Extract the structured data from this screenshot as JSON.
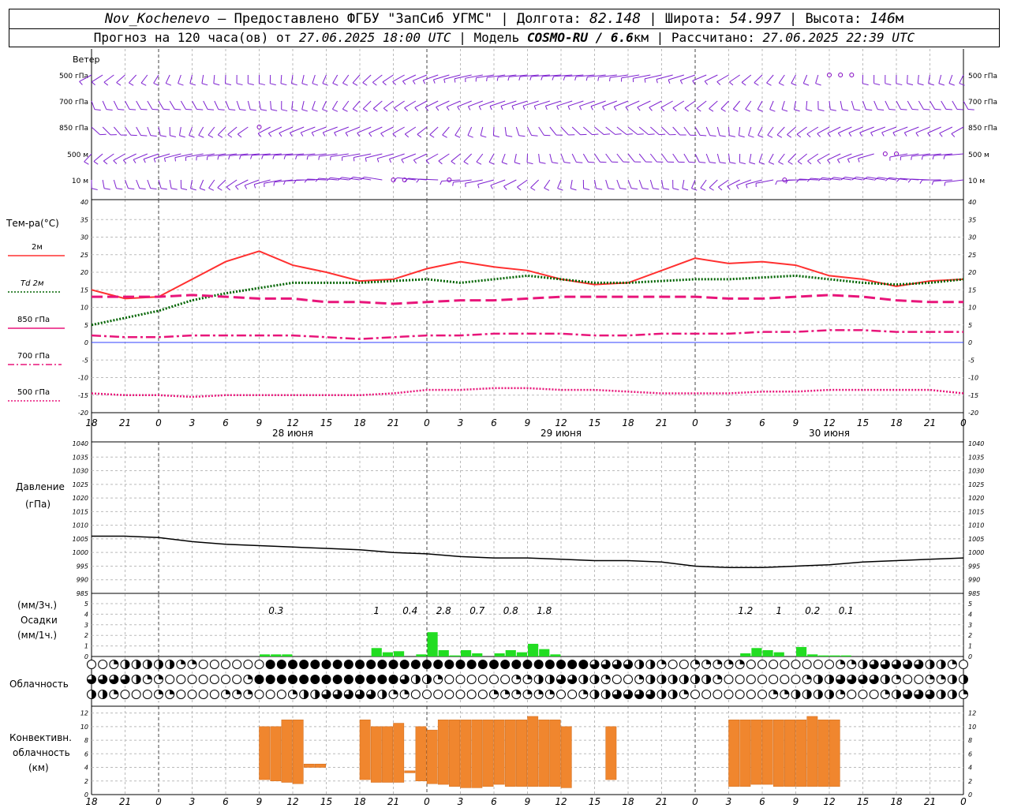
{
  "header": {
    "station": "Nov_Kochenevo",
    "provider": "Предоставлено ФГБУ \"ЗапСиб УГМС\"",
    "lon_label": "Долгота:",
    "lon": "82.148",
    "lat_label": "Широта:",
    "lat": "54.997",
    "alt_label": "Высота:",
    "alt": "146",
    "alt_unit": "м",
    "forecast_label": "Прогноз на 120 часа(ов) от",
    "forecast_from": "27.06.2025 18:00 UTC",
    "model_label": "Модель",
    "model": "COSMO-RU / 6.6",
    "model_unit": "км",
    "computed_label": "Рассчитано:",
    "computed": "27.06.2025 22:39 UTC"
  },
  "wind": {
    "title": "Ветер",
    "levels": [
      "500 гПа",
      "700 гПа",
      "850 гПа",
      "500 м",
      "10  м"
    ]
  },
  "temperature": {
    "title": "Тем-ра(°C)",
    "legend": [
      {
        "label": "2м",
        "color": "#ff3030",
        "style": "solid"
      },
      {
        "label": "Td  2м",
        "color": "#006400",
        "style": "dotted"
      },
      {
        "label": "850 гПа",
        "color": "#e8157a",
        "style": "dash"
      },
      {
        "label": "700 гПа",
        "color": "#e8157a",
        "style": "dashdot"
      },
      {
        "label": "500 гПа",
        "color": "#e8157a",
        "style": "dot"
      }
    ]
  },
  "pressure": {
    "title": "Давление",
    "unit": "(гПа)"
  },
  "precip": {
    "title1": "(мм/3ч.)",
    "title2": "Осадки",
    "title3": "(мм/1ч.)"
  },
  "cloudiness": {
    "title": "Облачность"
  },
  "convective": {
    "title1": "Конвективн.",
    "title2": "облачность",
    "title3": "(км)"
  },
  "time_axis": {
    "hour_labels": [
      "18",
      "21",
      "0",
      "3",
      "6",
      "9",
      "12",
      "15",
      "18",
      "21",
      "0",
      "3",
      "6",
      "9",
      "12",
      "15",
      "18",
      "21",
      "0",
      "3",
      "6",
      "9",
      "12",
      "15",
      "18",
      "21",
      "0"
    ],
    "day_labels": [
      "28 июня",
      "29 июня",
      "30 июня"
    ]
  },
  "chart_data": [
    {
      "type": "line",
      "title": "Тем-ра(°C)",
      "x_hours": [
        0,
        3,
        6,
        9,
        12,
        15,
        18,
        21,
        24,
        27,
        30,
        33,
        36,
        39,
        42,
        45,
        48,
        51,
        54,
        57,
        60,
        63,
        66,
        69,
        72,
        75,
        78
      ],
      "ylim": [
        -20,
        40
      ],
      "series": [
        {
          "name": "2м",
          "values": [
            15,
            12.5,
            13,
            18,
            23,
            26,
            22,
            20,
            17.5,
            18,
            21,
            23,
            21.5,
            20.5,
            18,
            16.5,
            17,
            20.5,
            24,
            22.5,
            23,
            22,
            19,
            18,
            16,
            17.5,
            18
          ]
        },
        {
          "name": "Td  2м",
          "values": [
            5,
            7,
            9,
            12,
            14,
            15.5,
            17,
            17,
            17,
            17.5,
            18,
            17,
            18,
            19,
            18,
            17,
            17,
            17.5,
            18,
            18,
            18.5,
            19,
            18,
            17,
            16.5,
            17,
            18
          ]
        },
        {
          "name": "850 гПа",
          "values": [
            13,
            13,
            13,
            13.5,
            13,
            12.5,
            12.5,
            11.5,
            11.5,
            11,
            11.5,
            12,
            12,
            12.5,
            13,
            13,
            13,
            13,
            13,
            12.5,
            12.5,
            13,
            13.5,
            13,
            12,
            11.5,
            11.5
          ]
        },
        {
          "name": "700 гПа",
          "values": [
            2,
            1.5,
            1.5,
            2,
            2,
            2,
            2,
            1.5,
            1,
            1.5,
            2,
            2,
            2.5,
            2.5,
            2.5,
            2,
            2,
            2.5,
            2.5,
            2.5,
            3,
            3,
            3.5,
            3.5,
            3,
            3,
            3
          ]
        },
        {
          "name": "500 гПа",
          "values": [
            -14.5,
            -15,
            -15,
            -15.5,
            -15,
            -15,
            -15,
            -15,
            -15,
            -14.5,
            -13.5,
            -13.5,
            -13,
            -13,
            -13.5,
            -13.5,
            -14,
            -14.5,
            -14.5,
            -14.5,
            -14,
            -14,
            -13.5,
            -13.5,
            -13.5,
            -13.5,
            -14.5
          ]
        }
      ]
    },
    {
      "type": "line",
      "title": "Давление (гПа)",
      "x_hours": [
        0,
        3,
        6,
        9,
        12,
        15,
        18,
        21,
        24,
        27,
        30,
        33,
        36,
        39,
        42,
        45,
        48,
        51,
        54,
        57,
        60,
        63,
        66,
        69,
        72,
        75,
        78
      ],
      "ylim": [
        985,
        1040
      ],
      "series": [
        {
          "name": "Давление",
          "values": [
            1006,
            1006,
            1005.5,
            1004,
            1003,
            1002.5,
            1002,
            1001.5,
            1001,
            1000,
            999.5,
            998.5,
            998,
            998,
            997.5,
            997,
            997,
            996.5,
            995,
            994.5,
            994.5,
            995,
            995.5,
            996.5,
            997,
            997.5,
            998
          ]
        }
      ]
    },
    {
      "type": "bar",
      "title": "Осадки",
      "ylim": [
        0,
        5
      ],
      "hourly_mm": [
        {
          "h": 15.5,
          "v": 0.2
        },
        {
          "h": 16.5,
          "v": 0.2
        },
        {
          "h": 17.5,
          "v": 0.2
        },
        {
          "h": 25.5,
          "v": 0.8
        },
        {
          "h": 26.5,
          "v": 0.4
        },
        {
          "h": 27.5,
          "v": 0.5
        },
        {
          "h": 29.5,
          "v": 0.2
        },
        {
          "h": 30.5,
          "v": 2.3
        },
        {
          "h": 31.5,
          "v": 0.6
        },
        {
          "h": 32.5,
          "v": 0.1
        },
        {
          "h": 33.5,
          "v": 0.6
        },
        {
          "h": 34.5,
          "v": 0.3
        },
        {
          "h": 36.5,
          "v": 0.3
        },
        {
          "h": 37.5,
          "v": 0.6
        },
        {
          "h": 38.5,
          "v": 0.4
        },
        {
          "h": 39.5,
          "v": 1.2
        },
        {
          "h": 40.5,
          "v": 0.7
        },
        {
          "h": 41.5,
          "v": 0.2
        },
        {
          "h": 58.5,
          "v": 0.3
        },
        {
          "h": 59.5,
          "v": 0.8
        },
        {
          "h": 60.5,
          "v": 0.6
        },
        {
          "h": 61.5,
          "v": 0.4
        },
        {
          "h": 63.5,
          "v": 0.9
        },
        {
          "h": 64.5,
          "v": 0.2
        },
        {
          "h": 65.5,
          "v": 0.1
        },
        {
          "h": 66.5,
          "v": 0.1
        },
        {
          "h": 67.5,
          "v": 0.1
        }
      ],
      "sum3h_labels": [
        {
          "h": 16.5,
          "label": "0.3"
        },
        {
          "h": 25.5,
          "label": "1"
        },
        {
          "h": 28.5,
          "label": "0.4"
        },
        {
          "h": 31.5,
          "label": "2.8"
        },
        {
          "h": 34.5,
          "label": "0.7"
        },
        {
          "h": 37.5,
          "label": "0.8"
        },
        {
          "h": 40.5,
          "label": "1.8"
        },
        {
          "h": 58.5,
          "label": "1.2"
        },
        {
          "h": 61.5,
          "label": "1"
        },
        {
          "h": 64.5,
          "label": "0.2"
        },
        {
          "h": 67.5,
          "label": "0.1"
        }
      ]
    },
    {
      "type": "bar",
      "title": "Конвективн. облачность (км)",
      "ylim": [
        0,
        12
      ],
      "note": "floating bars base..top in km",
      "bars": [
        {
          "h": 15.5,
          "base": 2.2,
          "top": 10
        },
        {
          "h": 16.5,
          "base": 2.0,
          "top": 10
        },
        {
          "h": 17.5,
          "base": 1.8,
          "top": 11
        },
        {
          "h": 18.5,
          "base": 1.6,
          "top": 11
        },
        {
          "h": 19.5,
          "base": 4.0,
          "top": 4.5
        },
        {
          "h": 20.5,
          "base": 4.0,
          "top": 4.5
        },
        {
          "h": 24.5,
          "base": 2.2,
          "top": 11
        },
        {
          "h": 25.5,
          "base": 1.8,
          "top": 10
        },
        {
          "h": 26.5,
          "base": 1.8,
          "top": 10
        },
        {
          "h": 27.5,
          "base": 1.8,
          "top": 10.5
        },
        {
          "h": 28.5,
          "base": 3.2,
          "top": 3.5
        },
        {
          "h": 29.5,
          "base": 2.0,
          "top": 10
        },
        {
          "h": 30.5,
          "base": 1.6,
          "top": 9.5
        },
        {
          "h": 31.5,
          "base": 1.5,
          "top": 11
        },
        {
          "h": 32.5,
          "base": 1.2,
          "top": 11
        },
        {
          "h": 33.5,
          "base": 1.0,
          "top": 11
        },
        {
          "h": 34.5,
          "base": 1.0,
          "top": 11
        },
        {
          "h": 35.5,
          "base": 1.2,
          "top": 11
        },
        {
          "h": 36.5,
          "base": 1.5,
          "top": 11
        },
        {
          "h": 37.5,
          "base": 1.2,
          "top": 11
        },
        {
          "h": 38.5,
          "base": 1.2,
          "top": 11
        },
        {
          "h": 39.5,
          "base": 1.2,
          "top": 11.5
        },
        {
          "h": 40.5,
          "base": 1.2,
          "top": 11
        },
        {
          "h": 41.5,
          "base": 1.2,
          "top": 11
        },
        {
          "h": 42.5,
          "base": 1.0,
          "top": 10
        },
        {
          "h": 46.5,
          "base": 2.2,
          "top": 10
        },
        {
          "h": 57.5,
          "base": 1.2,
          "top": 11
        },
        {
          "h": 58.5,
          "base": 1.2,
          "top": 11
        },
        {
          "h": 59.5,
          "base": 1.5,
          "top": 11
        },
        {
          "h": 60.5,
          "base": 1.5,
          "top": 11
        },
        {
          "h": 61.5,
          "base": 1.2,
          "top": 11
        },
        {
          "h": 62.5,
          "base": 1.2,
          "top": 11
        },
        {
          "h": 63.5,
          "base": 1.2,
          "top": 11
        },
        {
          "h": 64.5,
          "base": 1.2,
          "top": 11.5
        },
        {
          "h": 65.5,
          "base": 1.2,
          "top": 11
        },
        {
          "h": 66.5,
          "base": 1.2,
          "top": 11
        }
      ]
    }
  ]
}
